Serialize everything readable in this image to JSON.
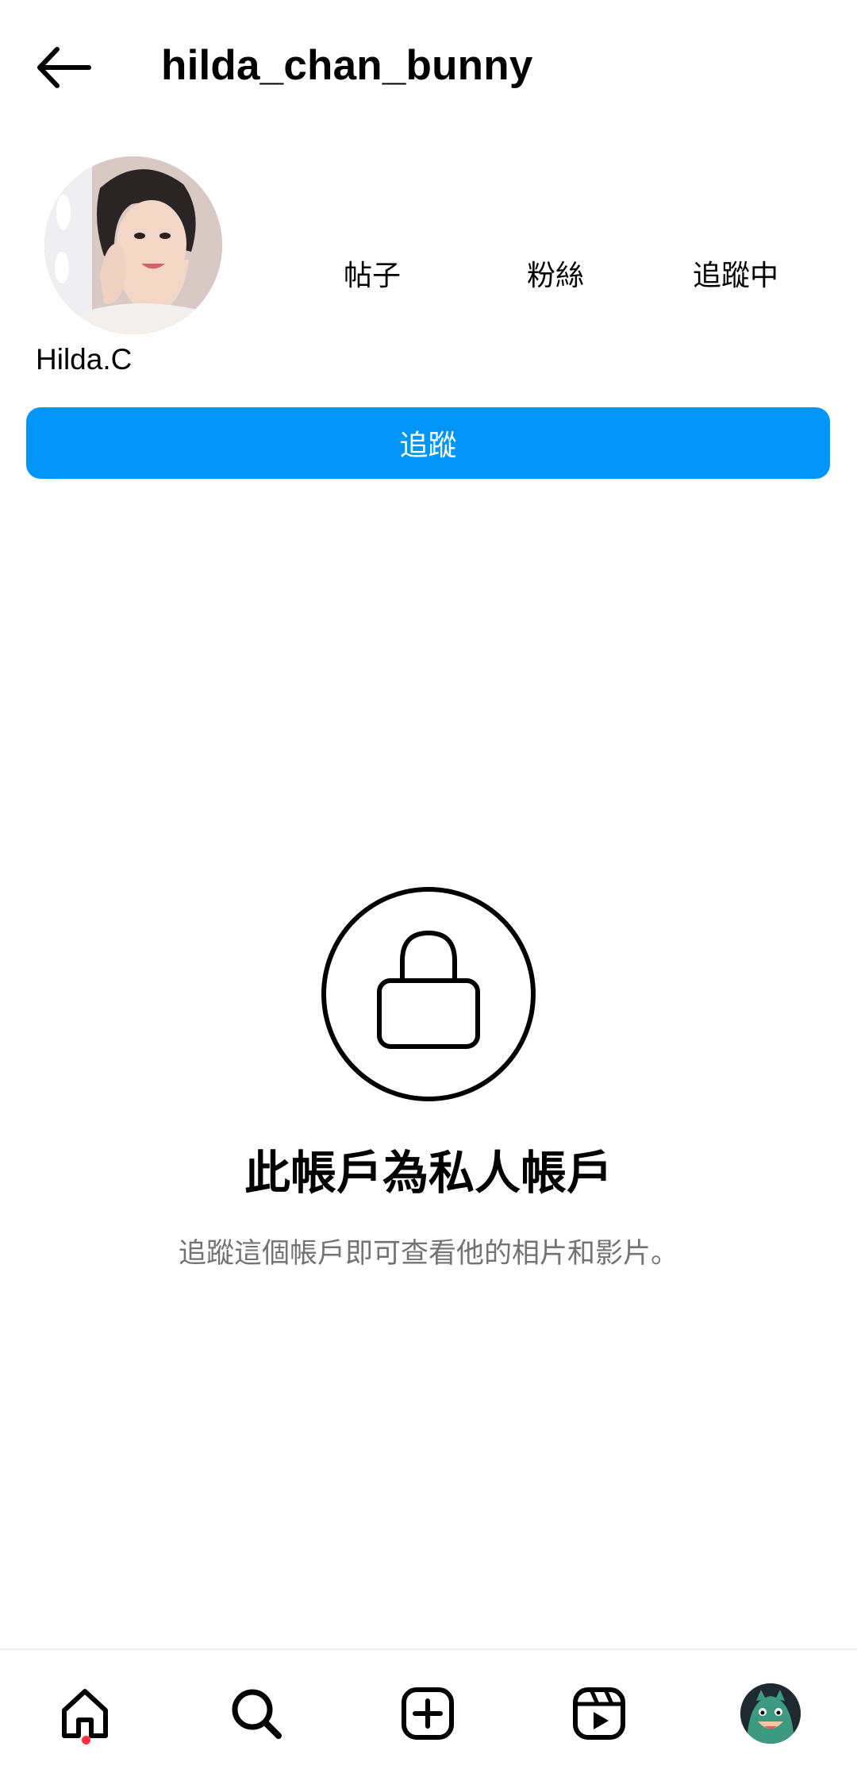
{
  "header": {
    "username": "hilda_chan_bunny",
    "back_icon": "arrow-left-icon"
  },
  "profile": {
    "display_name": "Hilda.C",
    "stats": {
      "posts_label": "帖子",
      "followers_label": "粉絲",
      "following_label": "追蹤中"
    },
    "follow_button": "追蹤",
    "follow_button_color": "#0095f6"
  },
  "private_notice": {
    "title": "此帳戶為私人帳戶",
    "subtitle": "追蹤這個帳戶即可查看他的相片和影片。",
    "icon": "lock-icon"
  },
  "bottom_nav": {
    "items": [
      "home-icon",
      "search-icon",
      "create-icon",
      "reels-icon",
      "profile-icon"
    ],
    "home_notification_dot_color": "#ff3040"
  }
}
